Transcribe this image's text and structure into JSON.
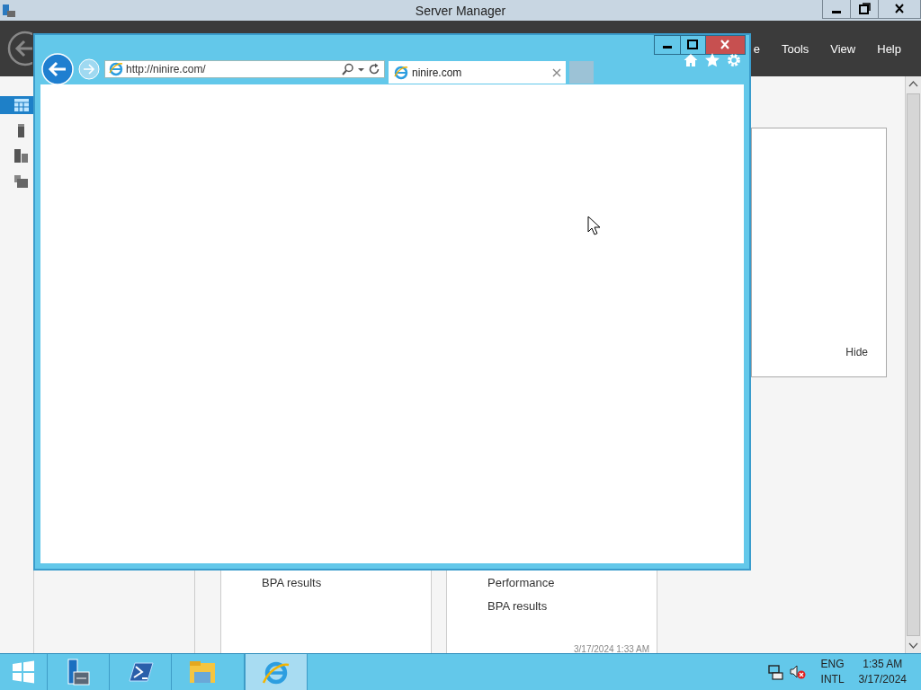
{
  "server_manager": {
    "title": "Server Manager",
    "menu": [
      {
        "label": "e"
      },
      {
        "label": "Tools"
      },
      {
        "label": "View"
      },
      {
        "label": "Help"
      }
    ],
    "nav": [
      {
        "kind": "dashboard",
        "selected": true
      },
      {
        "kind": "server",
        "selected": false
      },
      {
        "kind": "servers",
        "selected": false
      },
      {
        "kind": "roles",
        "selected": false
      }
    ],
    "welcome_panel": {
      "hide_link": "Hide"
    },
    "tiles": [
      {
        "items": [
          "BPA results"
        ]
      },
      {
        "items": [
          "Performance",
          "BPA results"
        ],
        "timestamp": "3/17/2024 1:33 AM"
      }
    ]
  },
  "browser": {
    "address": "http://ninire.com/",
    "tabs": [
      {
        "title": "ninire.com",
        "selected": true
      }
    ]
  },
  "taskbar": {
    "apps": [
      {
        "kind": "server-manager",
        "active": false
      },
      {
        "kind": "powershell",
        "active": false
      },
      {
        "kind": "explorer",
        "active": false
      },
      {
        "kind": "ie",
        "active": true
      }
    ],
    "language": "ENG",
    "layout": "INTL",
    "time": "1:35 AM",
    "date": "3/17/2024"
  }
}
